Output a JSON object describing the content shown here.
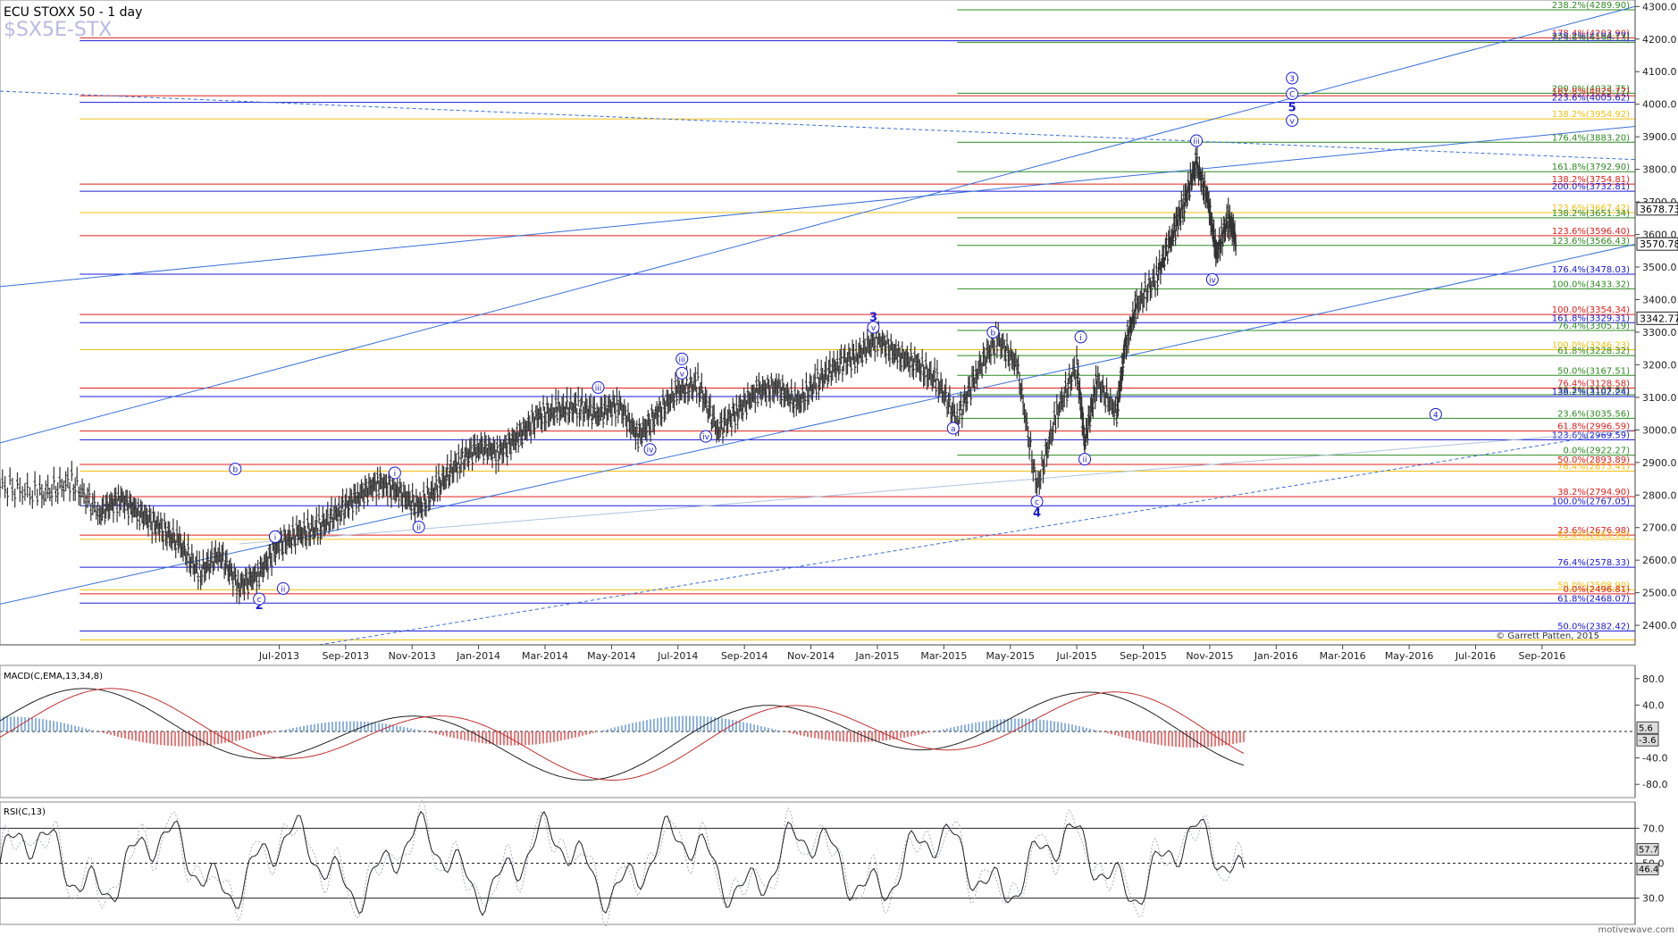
{
  "header": {
    "title": "ECU STOXX 50 - 1 day",
    "symbol": "$SX5E-STX"
  },
  "footer": {
    "copyright": "© Garrett Patten, 2015",
    "watermark": "motivewave.com"
  },
  "colors": {
    "red": "#e0201b",
    "blue": "#1a1ad8",
    "green": "#2e8b22",
    "yellow": "#f0c010",
    "steelblue": "#3a6fd8",
    "price": "#333333"
  },
  "chart_data": [
    {
      "type": "bar",
      "name": "price",
      "y_axis": {
        "min": 2340,
        "max": 4320,
        "ticks": [
          2400,
          2500,
          2600,
          2700,
          2800,
          2900,
          3000,
          3100,
          3200,
          3300,
          3400,
          3500,
          3600,
          3700,
          3800,
          3900,
          4000,
          4100,
          4200,
          4300
        ]
      },
      "x_labels": [
        "Jul-2013",
        "Sep-2013",
        "Nov-2013",
        "Jan-2014",
        "Mar-2014",
        "May-2014",
        "Jul-2014",
        "Sep-2014",
        "Nov-2014",
        "Jan-2015",
        "Mar-2015",
        "May-2015",
        "Jul-2015",
        "Sep-2015",
        "Nov-2015",
        "Jan-2016",
        "Mar-2016",
        "May-2016",
        "Jul-2016",
        "Sep-2016"
      ],
      "price_labels": [
        {
          "value": 3678.73,
          "text": "3678.73"
        },
        {
          "value": 3570.78,
          "text": "3570.78"
        },
        {
          "value": 3342.77,
          "text": "3342.77"
        }
      ],
      "fib_levels": [
        {
          "value": 4289.9,
          "text": "238.2%(4289.90)",
          "color": "green",
          "from": 2015.2
        },
        {
          "value": 4203.9,
          "text": "178.4%(4203.90)",
          "color": "red",
          "from": 2013.0
        },
        {
          "value": 4194.77,
          "text": "238.2%(4194.77)",
          "color": "blue",
          "from": 2013.0
        },
        {
          "value": 4190.13,
          "text": "223.6%(4190.13)",
          "color": "green",
          "from": 2015.2
        },
        {
          "value": 4033.75,
          "text": "200.0%(4033.75)",
          "color": "green",
          "from": 2015.2
        },
        {
          "value": 4025.77,
          "text": "161.8%(4025.77)",
          "color": "red",
          "from": 2013.0
        },
        {
          "value": 4005.62,
          "text": "223.6%(4005.62)",
          "color": "blue",
          "from": 2013.0
        },
        {
          "value": 3954.92,
          "text": "138.2%(3954.92)",
          "color": "yellow",
          "from": 2013.0
        },
        {
          "value": 3883.2,
          "text": "176.4%(3883.20)",
          "color": "green",
          "from": 2015.2
        },
        {
          "value": 3792.9,
          "text": "161.8%(3792.90)",
          "color": "green",
          "from": 2015.2
        },
        {
          "value": 3754.81,
          "text": "138.2%(3754.81)",
          "color": "red",
          "from": 2013.0
        },
        {
          "value": 3732.81,
          "text": "200.0%(3732.81)",
          "color": "blue",
          "from": 2013.0
        },
        {
          "value": 3667.42,
          "text": "123.6%(3667.42)",
          "color": "yellow",
          "from": 2013.0
        },
        {
          "value": 3651.34,
          "text": "138.2%(3651.34)",
          "color": "green",
          "from": 2015.2
        },
        {
          "value": 3596.4,
          "text": "123.6%(3596.40)",
          "color": "red",
          "from": 2013.0
        },
        {
          "value": 3566.43,
          "text": "123.6%(3566.43)",
          "color": "green",
          "from": 2015.2
        },
        {
          "value": 3478.03,
          "text": "176.4%(3478.03)",
          "color": "blue",
          "from": 2013.0
        },
        {
          "value": 3433.32,
          "text": "100.0%(3433.32)",
          "color": "green",
          "from": 2015.2
        },
        {
          "value": 3354.34,
          "text": "100.0%(3354.34)",
          "color": "red",
          "from": 2013.0
        },
        {
          "value": 3329.31,
          "text": "161.8%(3329.31)",
          "color": "blue",
          "from": 2013.0
        },
        {
          "value": 3305.19,
          "text": "76.4%(3305.19)",
          "color": "green",
          "from": 2015.2
        },
        {
          "value": 3246.23,
          "text": "100.0%(3246.23)",
          "color": "yellow",
          "from": 2013.0
        },
        {
          "value": 3228.32,
          "text": "61.8%(3228.32)",
          "color": "green",
          "from": 2015.2
        },
        {
          "value": 3167.51,
          "text": "50.0%(3167.51)",
          "color": "green",
          "from": 2015.2
        },
        {
          "value": 3128.58,
          "text": "76.4%(3128.58)",
          "color": "red",
          "from": 2013.0
        },
        {
          "value": 3107.84,
          "text": "38.2%(3107.84)",
          "color": "green",
          "from": 2015.2
        },
        {
          "value": 3102.24,
          "text": "138.2%(3102.24)",
          "color": "blue",
          "from": 2013.0
        },
        {
          "value": 3035.56,
          "text": "23.6%(3035.56)",
          "color": "green",
          "from": 2015.2
        },
        {
          "value": 2996.59,
          "text": "61.8%(2996.59)",
          "color": "red",
          "from": 2013.0
        },
        {
          "value": 2969.59,
          "text": "123.6%(2969.59)",
          "color": "blue",
          "from": 2013.0
        },
        {
          "value": 2922.27,
          "text": "0.0%(2922.27)",
          "color": "green",
          "from": 2015.2
        },
        {
          "value": 2893.89,
          "text": "50.0%(2893.89)",
          "color": "red",
          "from": 2013.0
        },
        {
          "value": 2873.41,
          "text": "76.4%(2873.41)",
          "color": "yellow",
          "from": 2013.0
        },
        {
          "value": 2794.9,
          "text": "38.2%(2794.90)",
          "color": "red",
          "from": 2013.0
        },
        {
          "value": 2767.05,
          "text": "100.0%(2767.05)",
          "color": "blue",
          "from": 2013.0
        },
        {
          "value": 2676.98,
          "text": "23.6%(2676.98)",
          "color": "red",
          "from": 2013.0
        },
        {
          "value": 2663.9,
          "text": "61.8%(2663.90)",
          "color": "yellow",
          "from": 2013.0
        },
        {
          "value": 2578.33,
          "text": "76.4%(2578.33)",
          "color": "blue",
          "from": 2013.0
        },
        {
          "value": 2508.9,
          "text": "50.0%(2508.90)",
          "color": "yellow",
          "from": 2013.0
        },
        {
          "value": 2496.81,
          "text": "0.0%(2496.81)",
          "color": "red",
          "from": 2013.0
        },
        {
          "value": 2468.07,
          "text": "61.8%(2468.07)",
          "color": "blue",
          "from": 2013.0
        },
        {
          "value": 2382.42,
          "text": "50.0%(2382.42)",
          "color": "blue",
          "from": 2013.0
        },
        {
          "value": 2355.0,
          "text": "",
          "color": "yellow",
          "from": 2013.0
        }
      ],
      "wave_labels": [
        {
          "t": 2013.45,
          "v": 2460,
          "text": "2",
          "style": "plain"
        },
        {
          "t": 2013.45,
          "v": 2481,
          "text": "c",
          "style": "circle"
        },
        {
          "t": 2013.51,
          "v": 2513,
          "text": "ii",
          "style": "circle"
        },
        {
          "t": 2013.49,
          "v": 2672,
          "text": "i",
          "style": "circle"
        },
        {
          "t": 2013.39,
          "v": 2880,
          "text": "b",
          "style": "circle"
        },
        {
          "t": 2013.79,
          "v": 2868,
          "text": "i",
          "style": "circle"
        },
        {
          "t": 2013.85,
          "v": 2702,
          "text": "ii",
          "style": "circle"
        },
        {
          "t": 2014.3,
          "v": 3130,
          "text": "iii",
          "style": "circle"
        },
        {
          "t": 2014.43,
          "v": 2940,
          "text": "iv",
          "style": "circle"
        },
        {
          "t": 2014.51,
          "v": 3174,
          "text": "v",
          "style": "circle"
        },
        {
          "t": 2014.51,
          "v": 3218,
          "text": "iii",
          "style": "circle"
        },
        {
          "t": 2014.57,
          "v": 2980,
          "text": "iv",
          "style": "circle"
        },
        {
          "t": 2014.99,
          "v": 3345,
          "text": "3",
          "style": "plain"
        },
        {
          "t": 2014.99,
          "v": 3315,
          "text": "v",
          "style": "circle"
        },
        {
          "t": 2015.19,
          "v": 3005,
          "text": "a",
          "style": "circle"
        },
        {
          "t": 2015.29,
          "v": 3300,
          "text": "b",
          "style": "circle"
        },
        {
          "t": 2015.4,
          "v": 2780,
          "text": "c",
          "style": "circle"
        },
        {
          "t": 2015.4,
          "v": 2745,
          "text": "4",
          "style": "plain"
        },
        {
          "t": 2015.52,
          "v": 2910,
          "text": "ii",
          "style": "circle"
        },
        {
          "t": 2015.51,
          "v": 3285,
          "text": "i",
          "style": "circle"
        },
        {
          "t": 2015.8,
          "v": 3888,
          "text": "iii",
          "style": "circle"
        },
        {
          "t": 2015.84,
          "v": 3462,
          "text": "iv",
          "style": "circle"
        },
        {
          "t": 2016.04,
          "v": 4080,
          "text": "3",
          "style": "circle"
        },
        {
          "t": 2016.04,
          "v": 4032,
          "text": "C",
          "style": "circle"
        },
        {
          "t": 2016.04,
          "v": 3990,
          "text": "5",
          "style": "plain"
        },
        {
          "t": 2016.04,
          "v": 3950,
          "text": "v",
          "style": "circle"
        },
        {
          "t": 2016.4,
          "v": 3048,
          "text": "4",
          "style": "circle"
        }
      ],
      "trendlines": [
        {
          "t1": 2012.8,
          "v1": 4040,
          "t2": 2016.9,
          "v2": 3830,
          "color": "steelblue",
          "dash": true
        },
        {
          "t1": 2012.8,
          "v1": 3440,
          "t2": 2016.9,
          "v2": 3932,
          "color": "steelblue",
          "dash": false
        },
        {
          "t1": 2012.8,
          "v1": 2960,
          "t2": 2016.9,
          "v2": 4300,
          "color": "steelblue",
          "dash": false
        },
        {
          "t1": 2012.8,
          "v1": 2465,
          "t2": 2016.9,
          "v2": 3570,
          "color": "steelblue",
          "dash": false
        },
        {
          "t1": 2013.4,
          "v1": 2650,
          "t2": 2016.9,
          "v2": 3000,
          "color": "lightsteelblue",
          "dash": false
        },
        {
          "t1": 2013.6,
          "v1": 2340,
          "t2": 2016.9,
          "v2": 3000,
          "color": "steelblue",
          "dash": true
        }
      ],
      "price_bars": [
        {
          "t": 2012.8,
          "v": 2830
        },
        {
          "t": 2012.9,
          "v": 2800
        },
        {
          "t": 2012.98,
          "v": 2840
        },
        {
          "t": 2013.05,
          "v": 2745
        },
        {
          "t": 2013.1,
          "v": 2790
        },
        {
          "t": 2013.15,
          "v": 2745
        },
        {
          "t": 2013.2,
          "v": 2700
        },
        {
          "t": 2013.25,
          "v": 2650
        },
        {
          "t": 2013.3,
          "v": 2560
        },
        {
          "t": 2013.35,
          "v": 2620
        },
        {
          "t": 2013.4,
          "v": 2520
        },
        {
          "t": 2013.45,
          "v": 2560
        },
        {
          "t": 2013.5,
          "v": 2650
        },
        {
          "t": 2013.55,
          "v": 2680
        },
        {
          "t": 2013.6,
          "v": 2700
        },
        {
          "t": 2013.65,
          "v": 2750
        },
        {
          "t": 2013.7,
          "v": 2800
        },
        {
          "t": 2013.75,
          "v": 2840
        },
        {
          "t": 2013.8,
          "v": 2810
        },
        {
          "t": 2013.85,
          "v": 2760
        },
        {
          "t": 2013.9,
          "v": 2830
        },
        {
          "t": 2013.95,
          "v": 2900
        },
        {
          "t": 2014.0,
          "v": 2950
        },
        {
          "t": 2014.05,
          "v": 2930
        },
        {
          "t": 2014.1,
          "v": 2980
        },
        {
          "t": 2014.15,
          "v": 3040
        },
        {
          "t": 2014.2,
          "v": 3060
        },
        {
          "t": 2014.25,
          "v": 3070
        },
        {
          "t": 2014.3,
          "v": 3050
        },
        {
          "t": 2014.35,
          "v": 3080
        },
        {
          "t": 2014.4,
          "v": 2980
        },
        {
          "t": 2014.45,
          "v": 3050
        },
        {
          "t": 2014.5,
          "v": 3120
        },
        {
          "t": 2014.55,
          "v": 3140
        },
        {
          "t": 2014.6,
          "v": 3000
        },
        {
          "t": 2014.65,
          "v": 3060
        },
        {
          "t": 2014.7,
          "v": 3120
        },
        {
          "t": 2014.75,
          "v": 3130
        },
        {
          "t": 2014.8,
          "v": 3080
        },
        {
          "t": 2014.85,
          "v": 3150
        },
        {
          "t": 2014.9,
          "v": 3200
        },
        {
          "t": 2014.95,
          "v": 3230
        },
        {
          "t": 2015.0,
          "v": 3280
        },
        {
          "t": 2015.05,
          "v": 3230
        },
        {
          "t": 2015.1,
          "v": 3200
        },
        {
          "t": 2015.15,
          "v": 3150
        },
        {
          "t": 2015.2,
          "v": 3030
        },
        {
          "t": 2015.25,
          "v": 3180
        },
        {
          "t": 2015.3,
          "v": 3280
        },
        {
          "t": 2015.35,
          "v": 3200
        },
        {
          "t": 2015.4,
          "v": 2820
        },
        {
          "t": 2015.45,
          "v": 3050
        },
        {
          "t": 2015.5,
          "v": 3200
        },
        {
          "t": 2015.52,
          "v": 2960
        },
        {
          "t": 2015.55,
          "v": 3150
        },
        {
          "t": 2015.6,
          "v": 3050
        },
        {
          "t": 2015.62,
          "v": 3250
        },
        {
          "t": 2015.65,
          "v": 3380
        },
        {
          "t": 2015.7,
          "v": 3470
        },
        {
          "t": 2015.74,
          "v": 3600
        },
        {
          "t": 2015.77,
          "v": 3700
        },
        {
          "t": 2015.8,
          "v": 3820
        },
        {
          "t": 2015.83,
          "v": 3700
        },
        {
          "t": 2015.85,
          "v": 3540
        },
        {
          "t": 2015.88,
          "v": 3650
        },
        {
          "t": 2015.9,
          "v": 3580
        }
      ]
    },
    {
      "type": "line",
      "name": "MACD(C,EMA,13,34,8)",
      "title": "MACD(C,EMA,13,34,8)",
      "y_axis": {
        "min": -100,
        "max": 100,
        "ticks": [
          80.0,
          40.0,
          -40.0,
          -80.0
        ]
      },
      "marker_labels": [
        "5.6",
        "-3.6"
      ]
    },
    {
      "type": "line",
      "name": "RSI(C,13)",
      "title": "RSI(C,13)",
      "y_axis": {
        "min": 15,
        "max": 85,
        "ticks": [
          70.0,
          50.0,
          30.0
        ]
      },
      "marker_labels": [
        "57.7",
        "46.4"
      ]
    }
  ]
}
